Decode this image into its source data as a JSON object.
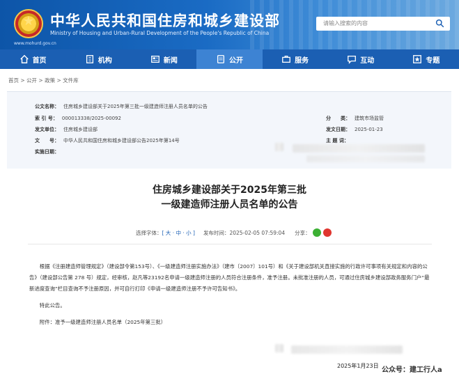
{
  "header": {
    "title": "中华人民共和国住房和城乡建设部",
    "subtitle": "Ministry of Housing and Urban-Rural Development of the People's Republic of China",
    "url": "www.mohurd.gov.cn",
    "search_placeholder": "请输入搜索的内容"
  },
  "nav": [
    {
      "label": "首页",
      "icon": "home-icon"
    },
    {
      "label": "机构",
      "icon": "building-icon"
    },
    {
      "label": "新闻",
      "icon": "news-icon"
    },
    {
      "label": "公开",
      "icon": "document-icon"
    },
    {
      "label": "服务",
      "icon": "service-icon"
    },
    {
      "label": "互动",
      "icon": "chat-icon"
    },
    {
      "label": "专题",
      "icon": "topic-icon"
    }
  ],
  "breadcrumb": "首页 > 公开 > 政策 > 文件库",
  "info": {
    "gongwen_label": "公文名称：",
    "gongwen_value": "住房城乡建设部关于2025年第三批一级建造师注册人员名单的公告",
    "suoyin_label": "索 引 号：",
    "suoyin_value": "000013338/2025-00092",
    "fenlei_label": "分　　类：",
    "fenlei_value": "建筑市场监管",
    "fawen_danwei_label": "发文单位：",
    "fawen_danwei_value": "住房城乡建设部",
    "fawen_riqi_label": "发文日期：",
    "fawen_riqi_value": "2025-01-23",
    "wenhao_label": "文　　号：",
    "wenhao_value": "中华人民共和国住房和城乡建设部公告2025年第14号",
    "zhuti_label": "主 题 词：",
    "shishi_label": "实施日期："
  },
  "article": {
    "title_line1": "住房城乡建设部关于2025年第三批",
    "title_line2": "一级建造师注册人员名单的公告",
    "font_label": "选择字体：",
    "font_sizes": "[ 大 · 中 · 小 ]",
    "publish_label": "发布时间：",
    "publish_time": "2025-02-05 07:59:04",
    "share_label": "分享：",
    "para1": "根据《注册建造师管理规定》（建设部令第153号）、《一级建造师注册实施办法》（建市〔2007〕101号）和《关于建设部机关直接实施的行政许可事项有关规定和内容的公告》（建设部公告第 278 号）规定，经审核，赵凡等23192名申请一级建造师注册的人员符合注册条件，准予注册。未批准注册的人员，可通过住房城乡建设部政务服务门户“最新进度查询”栏目查询不予注册原因，并可自行打印《申请一级建造师注册不予许可告知书》。",
    "para2": "特此公告。",
    "para3": "附件：准予一级建造师注册人员名单（2025年第三批）",
    "date": "2025年1月23日",
    "watermark": "公众号：建工行人a"
  },
  "colors": {
    "header_blue": "#0d55a8",
    "nav_blue": "#1b5fb3",
    "nav_active": "#3d83d3",
    "link_blue": "#1a5fb4",
    "wechat_green": "#3cb034",
    "weibo_red": "#e0362f"
  }
}
